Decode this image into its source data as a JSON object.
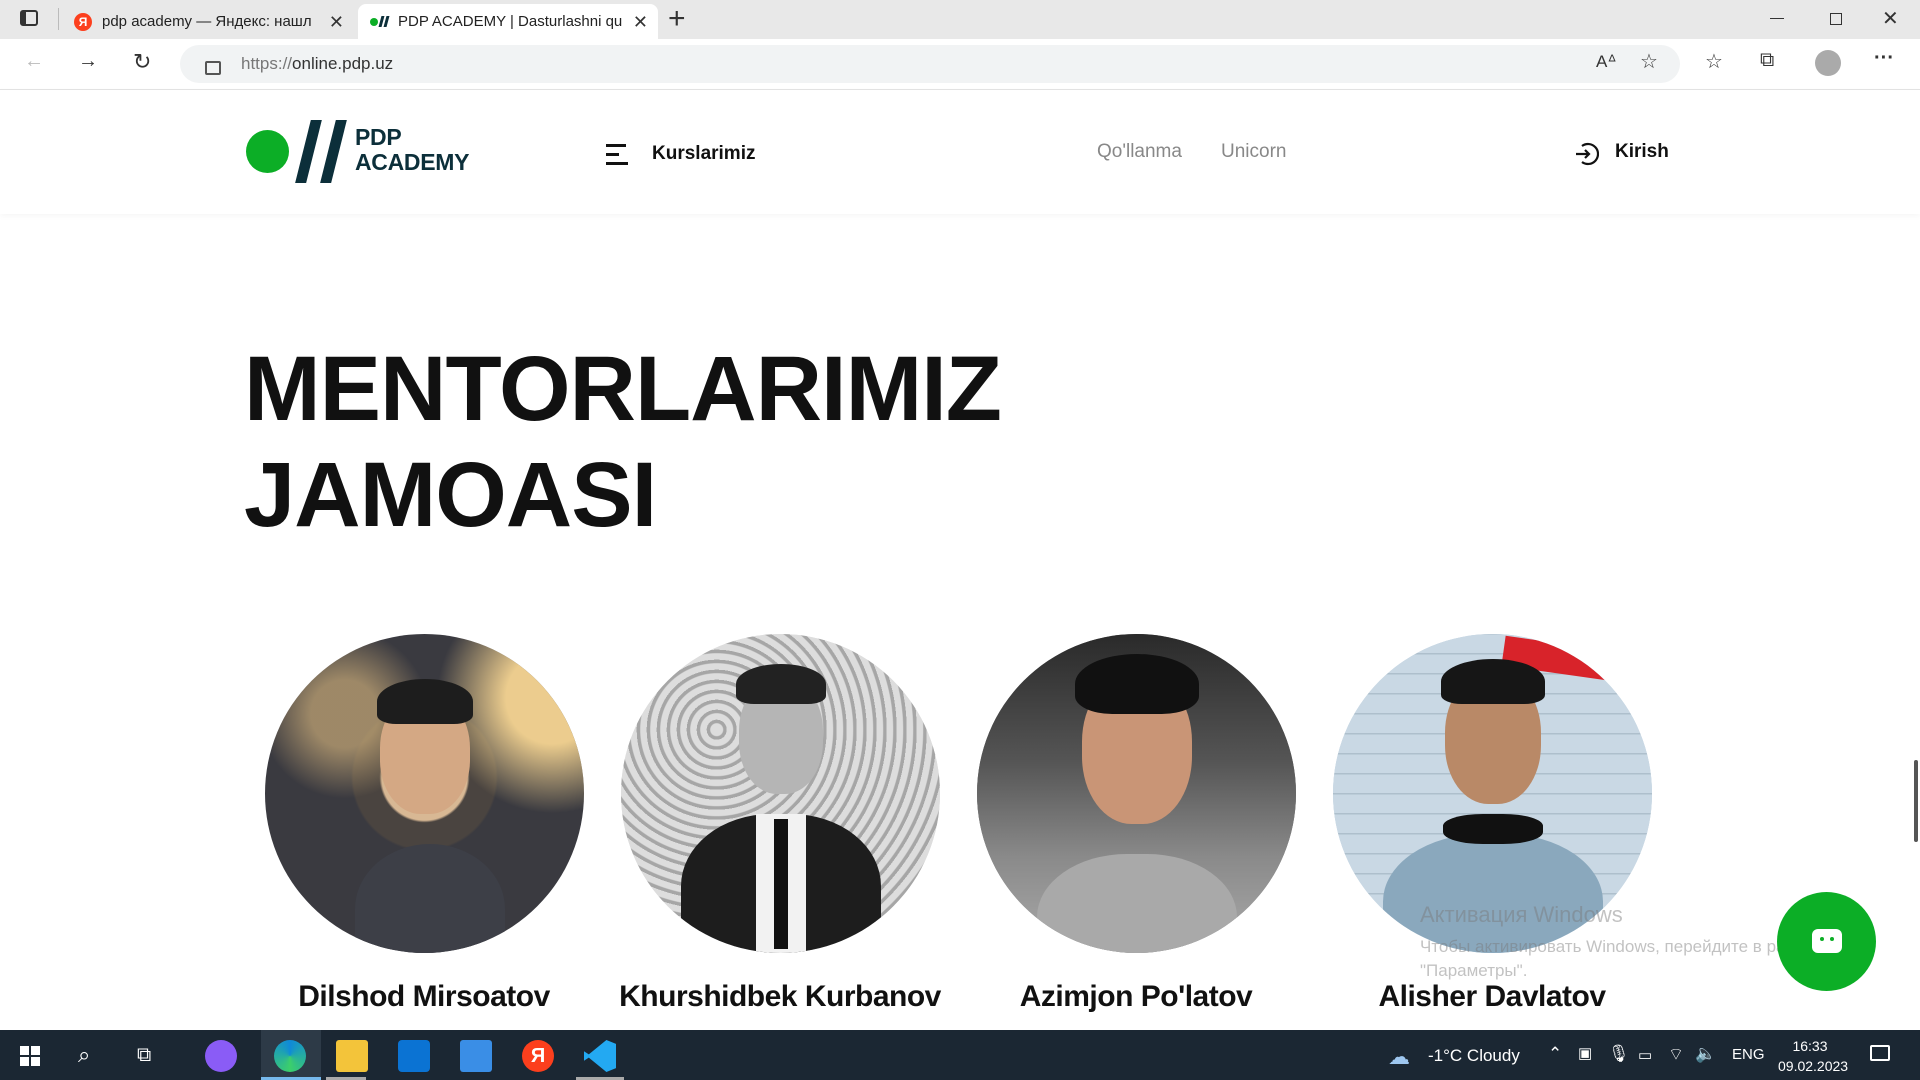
{
  "browser": {
    "tabs": [
      {
        "title": "pdp academy — Яндекс: нашлос",
        "favicon": "yandex-icon",
        "active": false
      },
      {
        "title": "PDP ACADEMY | Dasturlashni qu",
        "favicon": "pdp-favicon",
        "active": true
      }
    ],
    "new_tab_label": "+",
    "url_prefix": "https://",
    "url_host": "online.pdp.uz"
  },
  "site": {
    "logo_line1": "PDP",
    "logo_line2": "ACADEMY",
    "courses_label": "Kurslarimiz",
    "nav": [
      "Qo'llanma",
      "Unicorn"
    ],
    "login_label": "Kirish",
    "brand_color": "#0cae26"
  },
  "section": {
    "title_line1": "MENTORLARIMIZ",
    "title_line2": "JAMOASI"
  },
  "mentors": [
    {
      "name": "Dilshod Mirsoatov"
    },
    {
      "name": "Khurshidbek Kurbanov"
    },
    {
      "name": "Azimjon Po'latov"
    },
    {
      "name": "Alisher Davlatov"
    }
  ],
  "watermark": {
    "line1": "Активация Windows",
    "line2": "Чтобы активировать Windows, перейдите в раздел \"Параметры\"."
  },
  "taskbar": {
    "weather": "-1°C  Cloudy",
    "lang": "ENG",
    "time": "16:33",
    "date": "09.02.2023"
  }
}
